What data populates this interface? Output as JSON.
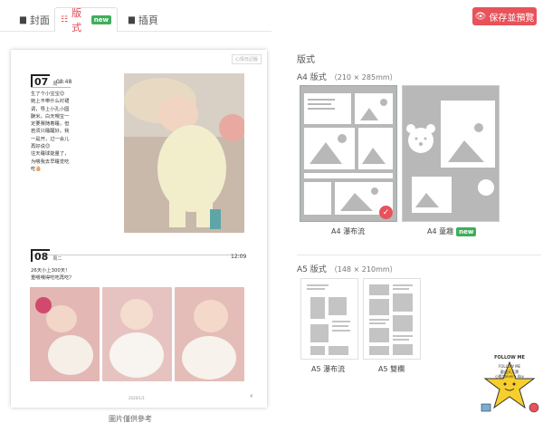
{
  "tabs": [
    {
      "label": "封面",
      "icon": "book-icon"
    },
    {
      "label": "版式",
      "icon": "grid-icon",
      "badge": "new",
      "active": true
    },
    {
      "label": "插頁",
      "icon": "bookmark-icon"
    }
  ],
  "save_button": {
    "label": "保存並預覽",
    "icon": "eye-icon"
  },
  "preview": {
    "watermark": "心情日記版",
    "entries": [
      {
        "day": "07",
        "weekday": "周一",
        "time": "08:48",
        "text": "生了个小宝宝😊\n她上不带什么衬裙\n调，导上小孔小圆\n酬米。白天喂宝一\n定要赛随着睡，但\n若须只睡醒好。我\n一是开，过一会儿\n再好说😊\n往天睡球能量了，\n为喂我去早睡觉吃\n吃🥚"
      },
      {
        "day": "08",
        "weekday": "周二",
        "time": "12:09",
        "text": "26天小上300天！\n重喂喂得吃吃再吃？"
      }
    ],
    "page_number": "2020/1/1",
    "corner_mark": "4",
    "caption": "圖片僅供參考"
  },
  "panel": {
    "title": "版式",
    "a4": {
      "title": "A4 版式",
      "dims": "（210 × 285mm）",
      "templates": [
        {
          "label": "A4 瀑布流",
          "selected": true
        },
        {
          "label": "A4 童趣",
          "badge": "new"
        }
      ]
    },
    "a5": {
      "title": "A5 版式",
      "dims": "（148 × 210mm）",
      "templates": [
        {
          "label": "A5 瀑布流"
        },
        {
          "label": "A5 雙欄"
        }
      ]
    }
  },
  "mascot": {
    "top_text": "FOLLOW ME",
    "line1": "歡迎天天寶",
    "line2": "小影說every day"
  },
  "colors": {
    "accent": "#e8525a",
    "badge_green": "#3fae5b",
    "template_gray": "#b8b8b8"
  }
}
